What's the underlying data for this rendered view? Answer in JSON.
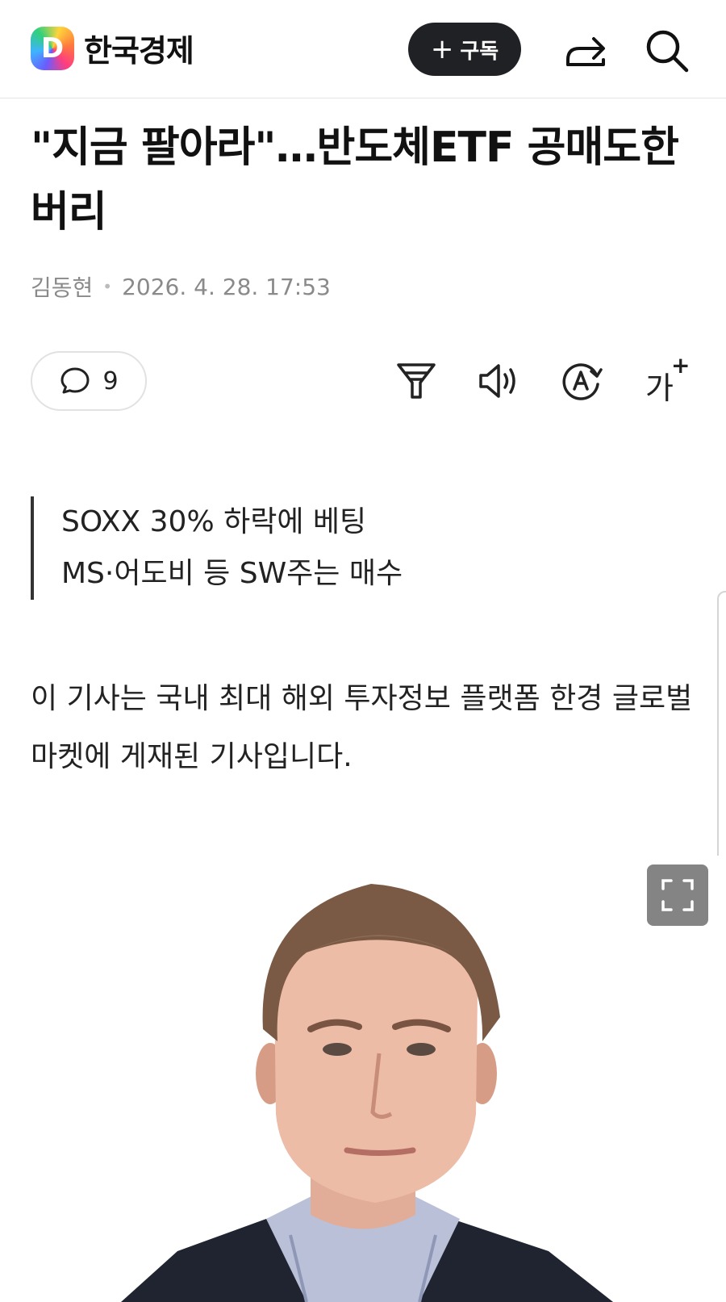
{
  "header": {
    "logo_letter": "D",
    "brand_name": "한국경제",
    "subscribe_label": "구독",
    "share_icon": "share-icon",
    "search_icon": "search-icon"
  },
  "article": {
    "headline": "\"지금 팔아라\"…반도체ETF 공매도한 버리",
    "author": "김동현",
    "timestamp": "2026. 4. 28. 17:53",
    "comment_count": "9",
    "font_size_label": "가",
    "summary": [
      "SOXX 30% 하락에 베팅",
      "MS·어도비 등 SW주는 매수"
    ],
    "body": "이 기사는 국내 최대 해외 투자정보 플랫폼 한경 글로벌마켓에 게재된 기사입니다."
  },
  "tools": {
    "filter_icon": "filter-icon",
    "speaker_icon": "speaker-icon",
    "translate_icon": "translate-icon",
    "font_size_icon": "font-size-icon"
  },
  "colors": {
    "subscribe_bg": "#202124",
    "text": "#111111",
    "meta": "#8a8a8a"
  }
}
